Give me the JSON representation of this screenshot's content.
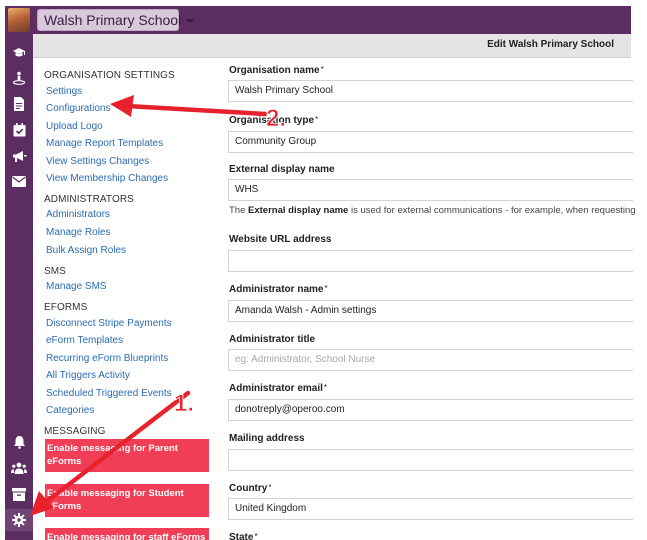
{
  "topbar": {
    "school_name": "Walsh Primary School"
  },
  "titlebar": {
    "title": "Edit Walsh Primary School"
  },
  "rail": {
    "top_icons": [
      "graduation-cap-icon",
      "person-location-icon",
      "document-icon",
      "calendar-check-icon",
      "megaphone-icon",
      "envelope-icon"
    ],
    "bottom_icons": [
      "bell-icon",
      "users-icon",
      "archive-icon",
      "gear-icon"
    ]
  },
  "nav": {
    "organisation": {
      "heading": "ORGANISATION SETTINGS",
      "items": [
        "Settings",
        "Configurations",
        "Upload Logo",
        "Manage Report Templates",
        "View Settings Changes",
        "View Membership Changes"
      ]
    },
    "administrators": {
      "heading": "ADMINISTRATORS",
      "items": [
        "Administrators",
        "Manage Roles",
        "Bulk Assign Roles"
      ]
    },
    "sms": {
      "heading": "SMS",
      "items": [
        "Manage SMS"
      ]
    },
    "eforms": {
      "heading": "EFORMS",
      "items": [
        "Disconnect Stripe Payments",
        "eForm Templates",
        "Recurring eForm Blueprints",
        "All Triggers Activity",
        "Scheduled Triggered Events",
        "Categories"
      ]
    },
    "messaging": {
      "heading": "MESSAGING",
      "buttons": [
        "Enable messaging for Parent eForms",
        "Enable messaging for Student eForms",
        "Enable messaging for staff eForms"
      ]
    }
  },
  "form": {
    "org_name": {
      "label": "Organisation name",
      "req": "*",
      "value": "Walsh Primary School"
    },
    "org_type": {
      "label": "Organisation type",
      "req": "*",
      "value": "Community Group"
    },
    "display_name": {
      "label": "External display name",
      "value": "WHS",
      "help_bold": "External display name",
      "help_pre": "The ",
      "help_post": " is used for external communications - for example, when requesting"
    },
    "website": {
      "label": "Website URL address",
      "value": ""
    },
    "admin_name": {
      "label": "Administrator name",
      "req": "*",
      "value": "Amanda Walsh - Admin settings"
    },
    "admin_title": {
      "label": "Administrator title",
      "placeholder": "eg: Administrator, School Nurse"
    },
    "admin_email": {
      "label": "Administrator email",
      "req": "*",
      "value": "donotreply@operoo.com"
    },
    "mailing": {
      "label": "Mailing address",
      "value": ""
    },
    "country": {
      "label": "Country",
      "req": "*",
      "value": "United Kingdom"
    },
    "state": {
      "label": "State",
      "req": "*"
    }
  },
  "annotations": {
    "step1": "1.",
    "step2": "2.",
    "arrow_color": "#e8222d"
  }
}
